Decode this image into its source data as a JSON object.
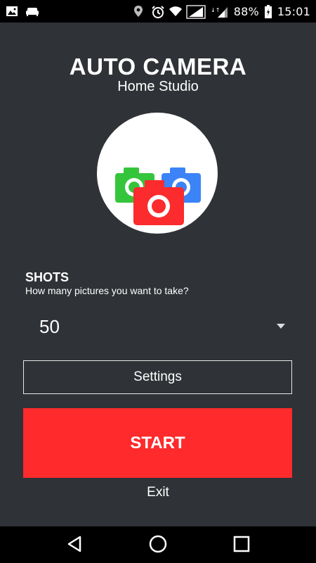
{
  "status_bar": {
    "battery_percent": "88%",
    "time": "15:01",
    "icons_left": [
      "image-icon",
      "sofa-icon"
    ],
    "icons_right": [
      "location-icon",
      "alarm-icon",
      "wifi-icon",
      "signal-icon",
      "signal-icon",
      "battery-icon"
    ]
  },
  "header": {
    "title": "AUTO CAMERA",
    "subtitle": "Home Studio"
  },
  "logo": {
    "icon": "camera-logo-icon",
    "colors": {
      "green": "#35c53c",
      "blue": "#3b83f7",
      "red": "#fc2b2d"
    }
  },
  "shots": {
    "label": "SHOTS",
    "hint": "How many pictures you want to take?",
    "selected_value": "50"
  },
  "buttons": {
    "settings": "Settings",
    "start": "START",
    "exit": "Exit"
  },
  "navigation": {
    "icons": [
      "back-icon",
      "home-icon",
      "recents-icon"
    ]
  },
  "colors": {
    "background": "#2f3236",
    "accent": "#fe2a2c"
  }
}
